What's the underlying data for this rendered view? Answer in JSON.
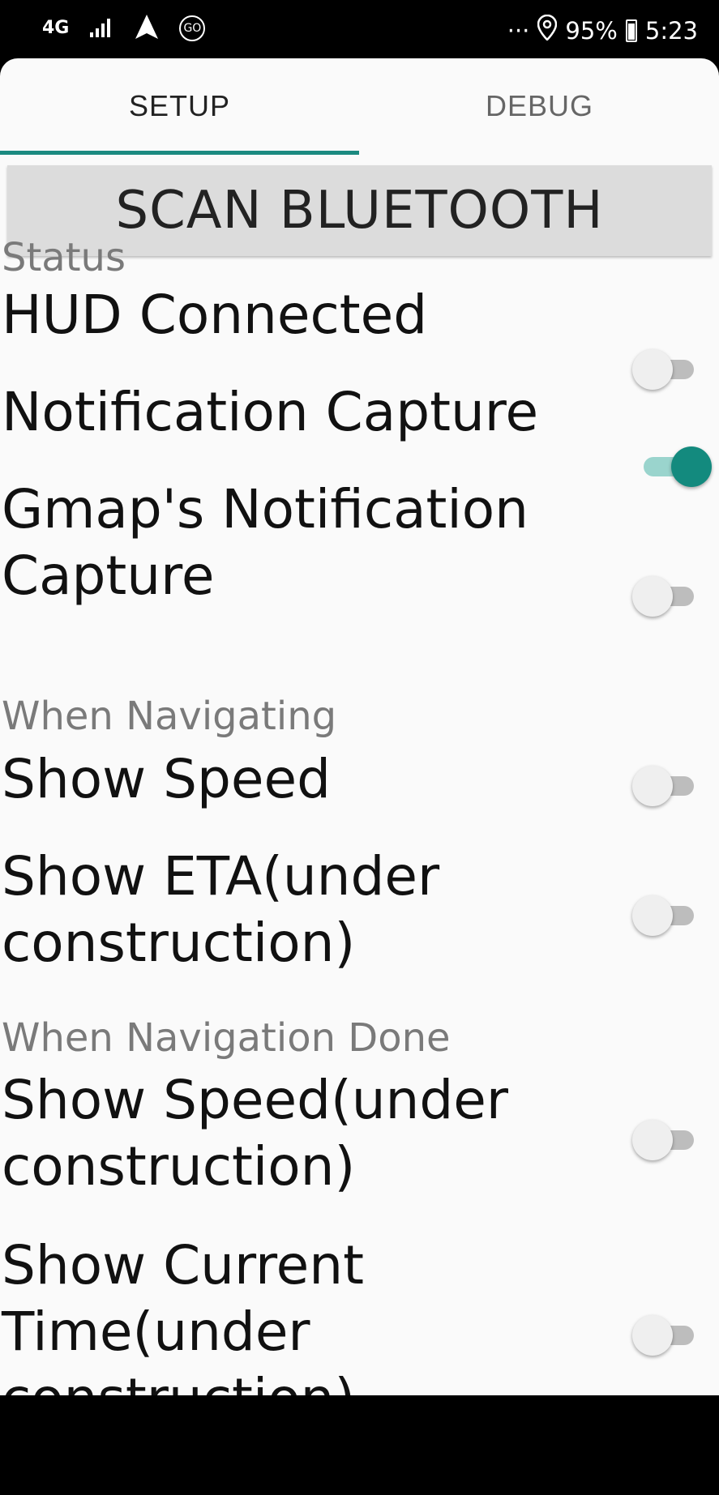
{
  "statusbar": {
    "network": "4G",
    "dots": "···",
    "battery": "95%",
    "time": "5:23",
    "go_badge": "GO"
  },
  "tabs": [
    {
      "label": "SETUP",
      "selected": true
    },
    {
      "label": "DEBUG",
      "selected": false
    }
  ],
  "scan_button": "SCAN BLUETOOTH",
  "sections": {
    "status": "Status",
    "navigating": "When Navigating",
    "nav_done": "When Navigation Done"
  },
  "settings": {
    "hud_connected": {
      "label": "HUD Connected",
      "on": false
    },
    "notification_capture": {
      "label": "Notification Capture",
      "on": true
    },
    "gmap_capture": {
      "label_line1": "Gmap's Notification",
      "label_line2": "Capture",
      "on": false
    },
    "show_speed": {
      "label": "Show Speed",
      "on": false
    },
    "show_eta": {
      "label_line1": "Show ETA(under",
      "label_line2": "construction)",
      "on": false
    },
    "done_show_speed": {
      "label_line1": "Show Speed(under",
      "label_line2": "construction)",
      "on": false
    },
    "show_time": {
      "label_line1": "Show Current",
      "label_line2": "Time(under",
      "label_line3": "construction)",
      "on": false
    }
  },
  "colors": {
    "accent": "#138a7e",
    "accent_track": "#9ad4cd",
    "tab_indicator": "#1b8a80",
    "background": "#fafafa"
  }
}
